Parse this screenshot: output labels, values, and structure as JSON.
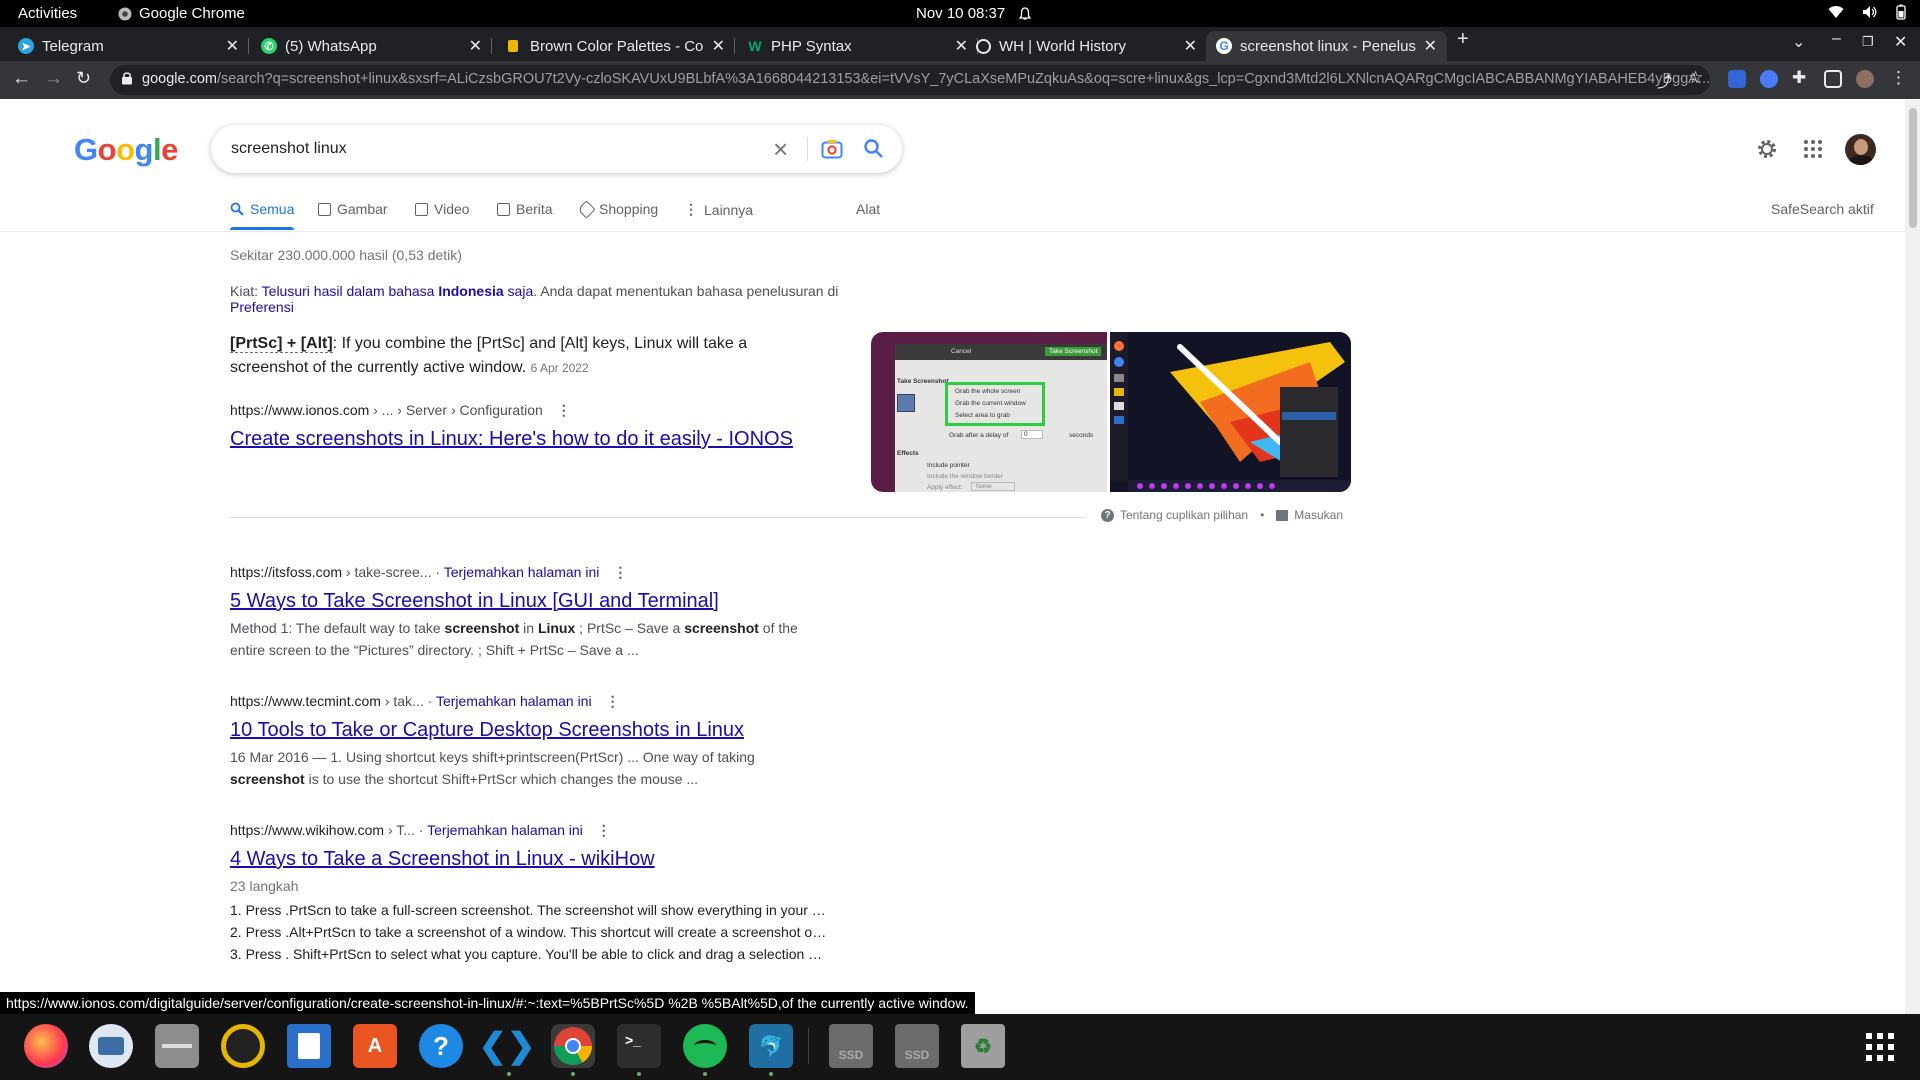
{
  "topbar": {
    "activities": "Activities",
    "app_name": "Google Chrome",
    "datetime": "Nov 10  08:37"
  },
  "tabs": [
    {
      "title": "Telegram",
      "favicon": "telegram-icon",
      "color": "#2aa3e0"
    },
    {
      "title": "(5) WhatsApp",
      "favicon": "whatsapp-icon",
      "color": "#25d366"
    },
    {
      "title": "Brown Color Palettes - Co",
      "favicon": "palette-icon",
      "color": "#f2b705"
    },
    {
      "title": "PHP Syntax",
      "favicon": "w3schools-icon",
      "color": "#04aa6d"
    },
    {
      "title": "WH | World History",
      "favicon": "globe-icon",
      "color": "#e8eaed"
    },
    {
      "title": "screenshot linux - Penelus",
      "favicon": "google-icon",
      "color": "#e8eaed"
    }
  ],
  "omnibox": {
    "domain": "google.com",
    "path": "/search?q=screenshot+linux&sxsrf=ALiCzsbGROU7t2Vy-czloSKAVUxU9BLbfA%3A1668044213153&ei=tVVsY_7yCLaXseMPuZqkuAs&oq=scre+linux&gs_lcp=Cgxnd3Mtd2l6LXNlcnAQARgCMgcIABCABBANMgYIABAHEB4yBggA..."
  },
  "search": {
    "query": "screenshot linux"
  },
  "search_tabs": [
    "Semua",
    "Gambar",
    "Video",
    "Berita",
    "Shopping",
    "Lainnya",
    "Alat"
  ],
  "safesearch": "SafeSearch aktif",
  "stats": "Sekitar 230.000.000 hasil (0,53 detik)",
  "hint": {
    "prefix": "Kiat: ",
    "link1": "Telusuri hasil dalam bahasa ",
    "bold": "Indonesia",
    "link2": " saja",
    "middle": ". Anda dapat menentukan bahasa penelusuran di ",
    "pref": "Preferensi"
  },
  "featured": {
    "bold": "[PrtSc] + [Alt]",
    "text": ": If you combine the [PrtSc] and [Alt] keys, Linux will take a screenshot of the currently active window.",
    "date": "6 Apr 2022",
    "cite": "https://www.ionos.com",
    "cite_path": " › ... › Server › Configuration",
    "title": "Create screenshots in Linux: Here's how to do it easily - IONOS",
    "about": "Tentang cuplikan pilihan",
    "feedback": "Masukan",
    "dot": "•"
  },
  "results": [
    {
      "cite": "https://itsfoss.com",
      "path": " › take-scree...",
      "translate": "Terjemahkan halaman ini",
      "title": "5 Ways to Take Screenshot in Linux [GUI and Terminal]",
      "desc_parts": [
        "Method 1: The default way to take ",
        "screenshot",
        " in ",
        "Linux",
        " ; PrtSc – Save a ",
        "screenshot",
        " of the entire screen to the “Pictures” directory. ; Shift + PrtSc – Save a ..."
      ]
    },
    {
      "cite": "https://www.tecmint.com",
      "path": " › tak...",
      "translate": "Terjemahkan halaman ini",
      "title": "10 Tools to Take or Capture Desktop Screenshots in Linux",
      "desc_parts": [
        "16 Mar 2016 — 1. Using shortcut keys shift+printscreen(PrtScr) ... One way of taking ",
        "screenshot",
        " is to use the shortcut Shift+PrtScr which changes the mouse ..."
      ]
    },
    {
      "cite": "https://www.wikihow.com",
      "path": " › T...",
      "translate": "Terjemahkan halaman ini",
      "title": "4 Ways to Take a Screenshot in Linux - wikiHow",
      "sub": "23 langkah",
      "steps": [
        "1.  Press .PrtScn to take a full-screen screenshot. The screenshot will show everything in your …",
        "2.  Press .Alt+PrtScn to take a screenshot of a window. This shortcut will create a screenshot o…",
        "3.  Press . Shift+PrtScn to select what you capture. You'll be able to click and drag a selection …"
      ]
    }
  ],
  "thumb1": {
    "cancel": "Cancel",
    "take": "Take Screenshot",
    "heading": "Take Screenshot",
    "opt1": "Grab the whole screen",
    "opt2": "Grab the current window",
    "opt3": "Select area to grab",
    "delay": "Grab after a delay of",
    "delay_val": "0",
    "seconds": "seconds",
    "effects": "Effects",
    "e1": "Include pointer",
    "e2": "Include the window border",
    "e3": "Apply effect:",
    "e3_val": "None"
  },
  "status_url": "https://www.ionos.com/digitalguide/server/configuration/create-screenshot-in-linux/#:~:text=%5BPrtSc%5D %2B %5BAlt%5D,of the currently active window.",
  "dock": [
    {
      "name": "firefox-icon",
      "color": "#ff7139"
    },
    {
      "name": "thunderbird-icon",
      "color": "#3b6ea5"
    },
    {
      "name": "files-icon",
      "color": "#8d8d8d"
    },
    {
      "name": "rhythmbox-icon",
      "color": "#e5b800"
    },
    {
      "name": "writer-icon",
      "color": "#2a6fc9"
    },
    {
      "name": "software-icon",
      "color": "#e95420"
    },
    {
      "name": "help-icon",
      "color": "#1e88e5"
    },
    {
      "name": "vscode-icon",
      "color": "#0078d4"
    },
    {
      "name": "chrome-icon",
      "color": "#4285f4"
    },
    {
      "name": "terminal-icon",
      "color": "#2d2d2d"
    },
    {
      "name": "spotify-icon",
      "color": "#1db954"
    },
    {
      "name": "mysql-workbench-icon",
      "color": "#1f6fa3"
    },
    {
      "name": "ssd-icon",
      "color": "#6b6b6b"
    },
    {
      "name": "ssd-icon",
      "color": "#6b6b6b"
    },
    {
      "name": "trash-icon",
      "color": "#9e9e9e"
    }
  ],
  "dock_labels": {
    "ssd": "SSD",
    "terminal": ">_"
  }
}
